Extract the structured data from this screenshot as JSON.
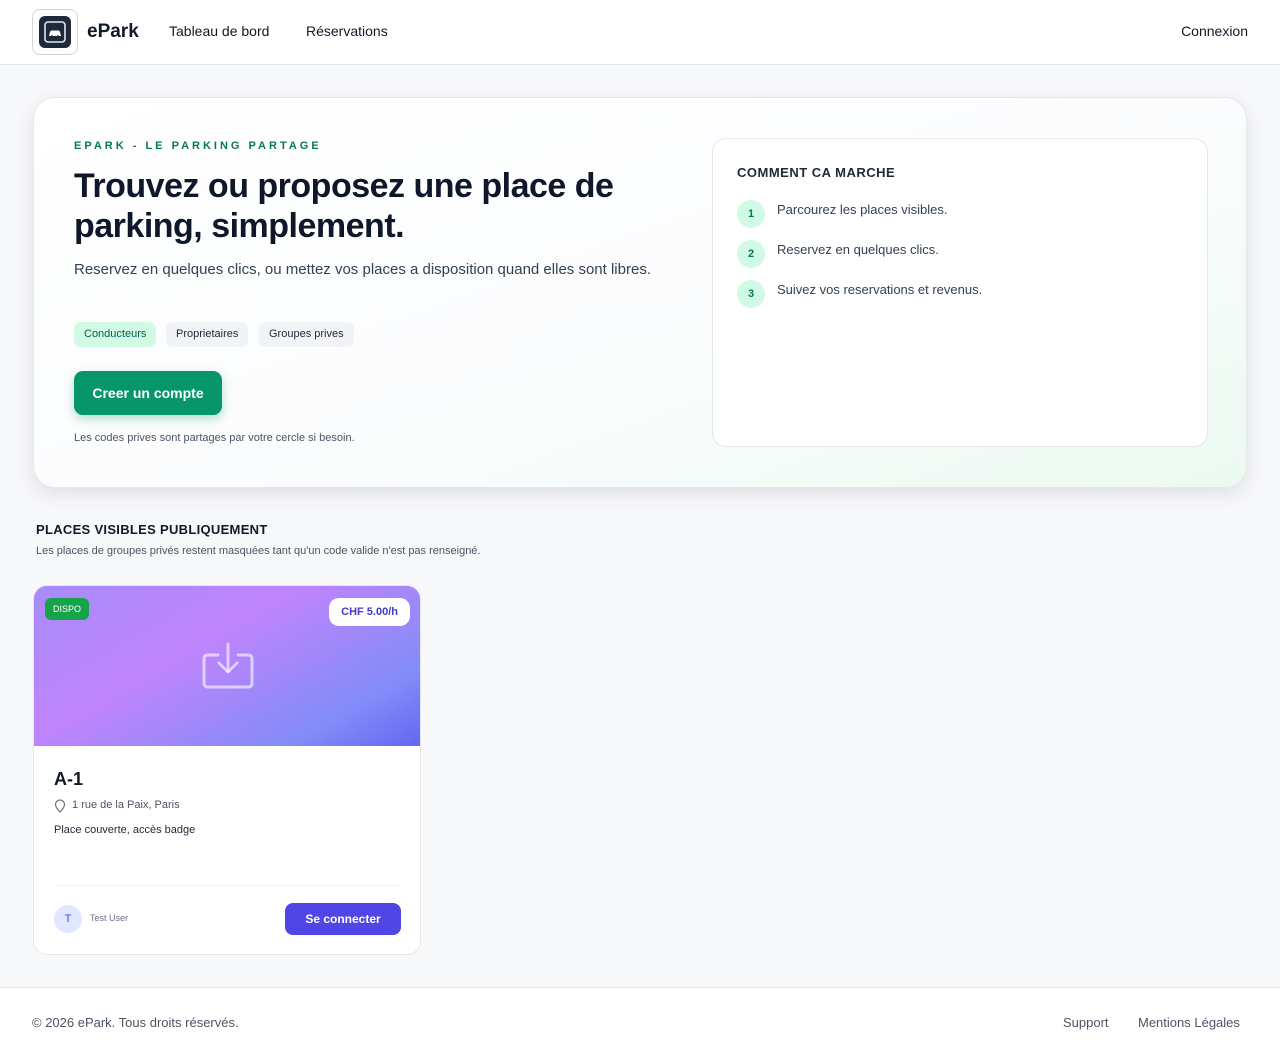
{
  "header": {
    "brand": "ePark",
    "nav": {
      "dashboard": "Tableau de bord",
      "reservations": "Réservations"
    },
    "login": "Connexion"
  },
  "hero": {
    "eyebrow": "EPARK - LE PARKING PARTAGE",
    "title": "Trouvez ou proposez une place de parking, simplement.",
    "subtitle": "Reservez en quelques clics, ou mettez vos places a disposition quand elles sont libres.",
    "chips": [
      "Conducteurs",
      "Proprietaires",
      "Groupes prives"
    ],
    "cta": "Creer un compte",
    "note": "Les codes prives sont partages par votre cercle si besoin."
  },
  "how": {
    "title": "COMMENT CA MARCHE",
    "steps": [
      {
        "num": "1",
        "text": "Parcourez les places visibles."
      },
      {
        "num": "2",
        "text": "Reservez en quelques clics."
      },
      {
        "num": "3",
        "text": "Suivez vos reservations et revenus."
      }
    ]
  },
  "section": {
    "title": "PLACES VISIBLES PUBLIQUEMENT",
    "subtitle": "Les places de groupes privés restent masquées tant qu'un code valide n'est pas renseigné."
  },
  "spot": {
    "status": "DISPO",
    "price": "CHF 5.00/h",
    "name": "A-1",
    "address": "1 rue de la Paix, Paris",
    "description": "Place couverte, accès badge",
    "owner_initial": "T",
    "owner_name": "Test User",
    "action": "Se connecter"
  },
  "footer": {
    "copyright": "© 2026 ePark. Tous droits réservés.",
    "support": "Support",
    "legal": "Mentions Légales"
  },
  "colors": {
    "primary_green": "#079669",
    "accent_indigo": "#4f46e5",
    "status_green": "#16a34a"
  },
  "icons": [
    "epark-logo-icon",
    "download-image-icon",
    "location-pin-icon"
  ]
}
